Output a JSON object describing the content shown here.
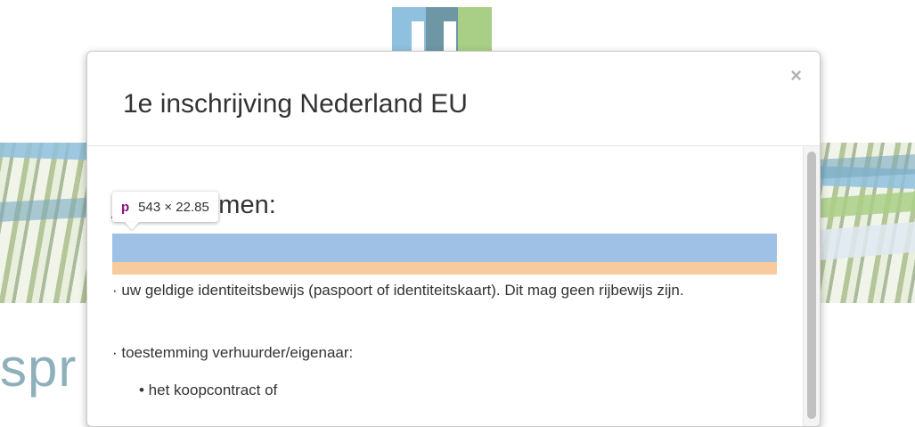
{
  "background": {
    "logo_colors": [
      "#8fc0dd",
      "#a9cf86",
      "#5f8a99"
    ],
    "partial_text": "spr"
  },
  "modal": {
    "title": "1e inschrijving Nederland EU",
    "close_icon": "×",
    "section_heading": "je meenemen:",
    "paragraphs": [
      "· uw geldige identiteitsbewijs (paspoort of identiteitskaart). Dit mag geen rijbewijs zijn.",
      "· toestemming verhuurder/eigenaar:"
    ],
    "bullets": [
      "• het koopcontract of"
    ]
  },
  "devtools_tooltip": {
    "tag": "p",
    "dimensions": "543 × 22.85",
    "highlight_colors": {
      "content": "#9fc1e6",
      "margin": "#f8cb9c"
    }
  }
}
